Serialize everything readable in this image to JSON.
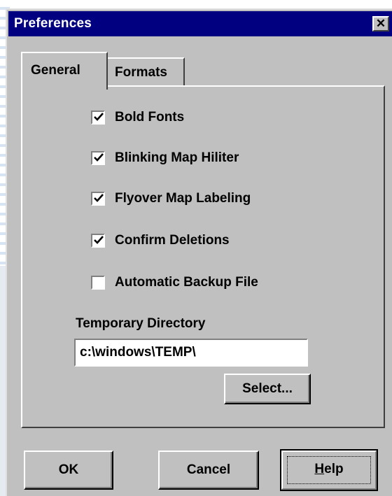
{
  "dialog": {
    "title": "Preferences",
    "close_glyph": "✕"
  },
  "tabs": [
    {
      "label": "General",
      "active": true
    },
    {
      "label": "Formats",
      "active": false
    }
  ],
  "options": [
    {
      "label": "Bold Fonts",
      "checked": true
    },
    {
      "label": "Blinking Map Hiliter",
      "checked": true
    },
    {
      "label": "Flyover Map Labeling",
      "checked": true
    },
    {
      "label": "Confirm Deletions",
      "checked": true
    },
    {
      "label": "Automatic Backup File",
      "checked": false
    }
  ],
  "temp_dir": {
    "label": "Temporary Directory",
    "value": "c:\\windows\\TEMP\\",
    "select_label": "Select..."
  },
  "buttons": {
    "ok": "OK",
    "cancel": "Cancel",
    "help_mnemonic": "H",
    "help_rest": "elp"
  },
  "colors": {
    "titlebar": "#000080",
    "face": "#c0c0c0"
  },
  "icons": {
    "close": "close-icon",
    "check": "checkmark-icon"
  }
}
